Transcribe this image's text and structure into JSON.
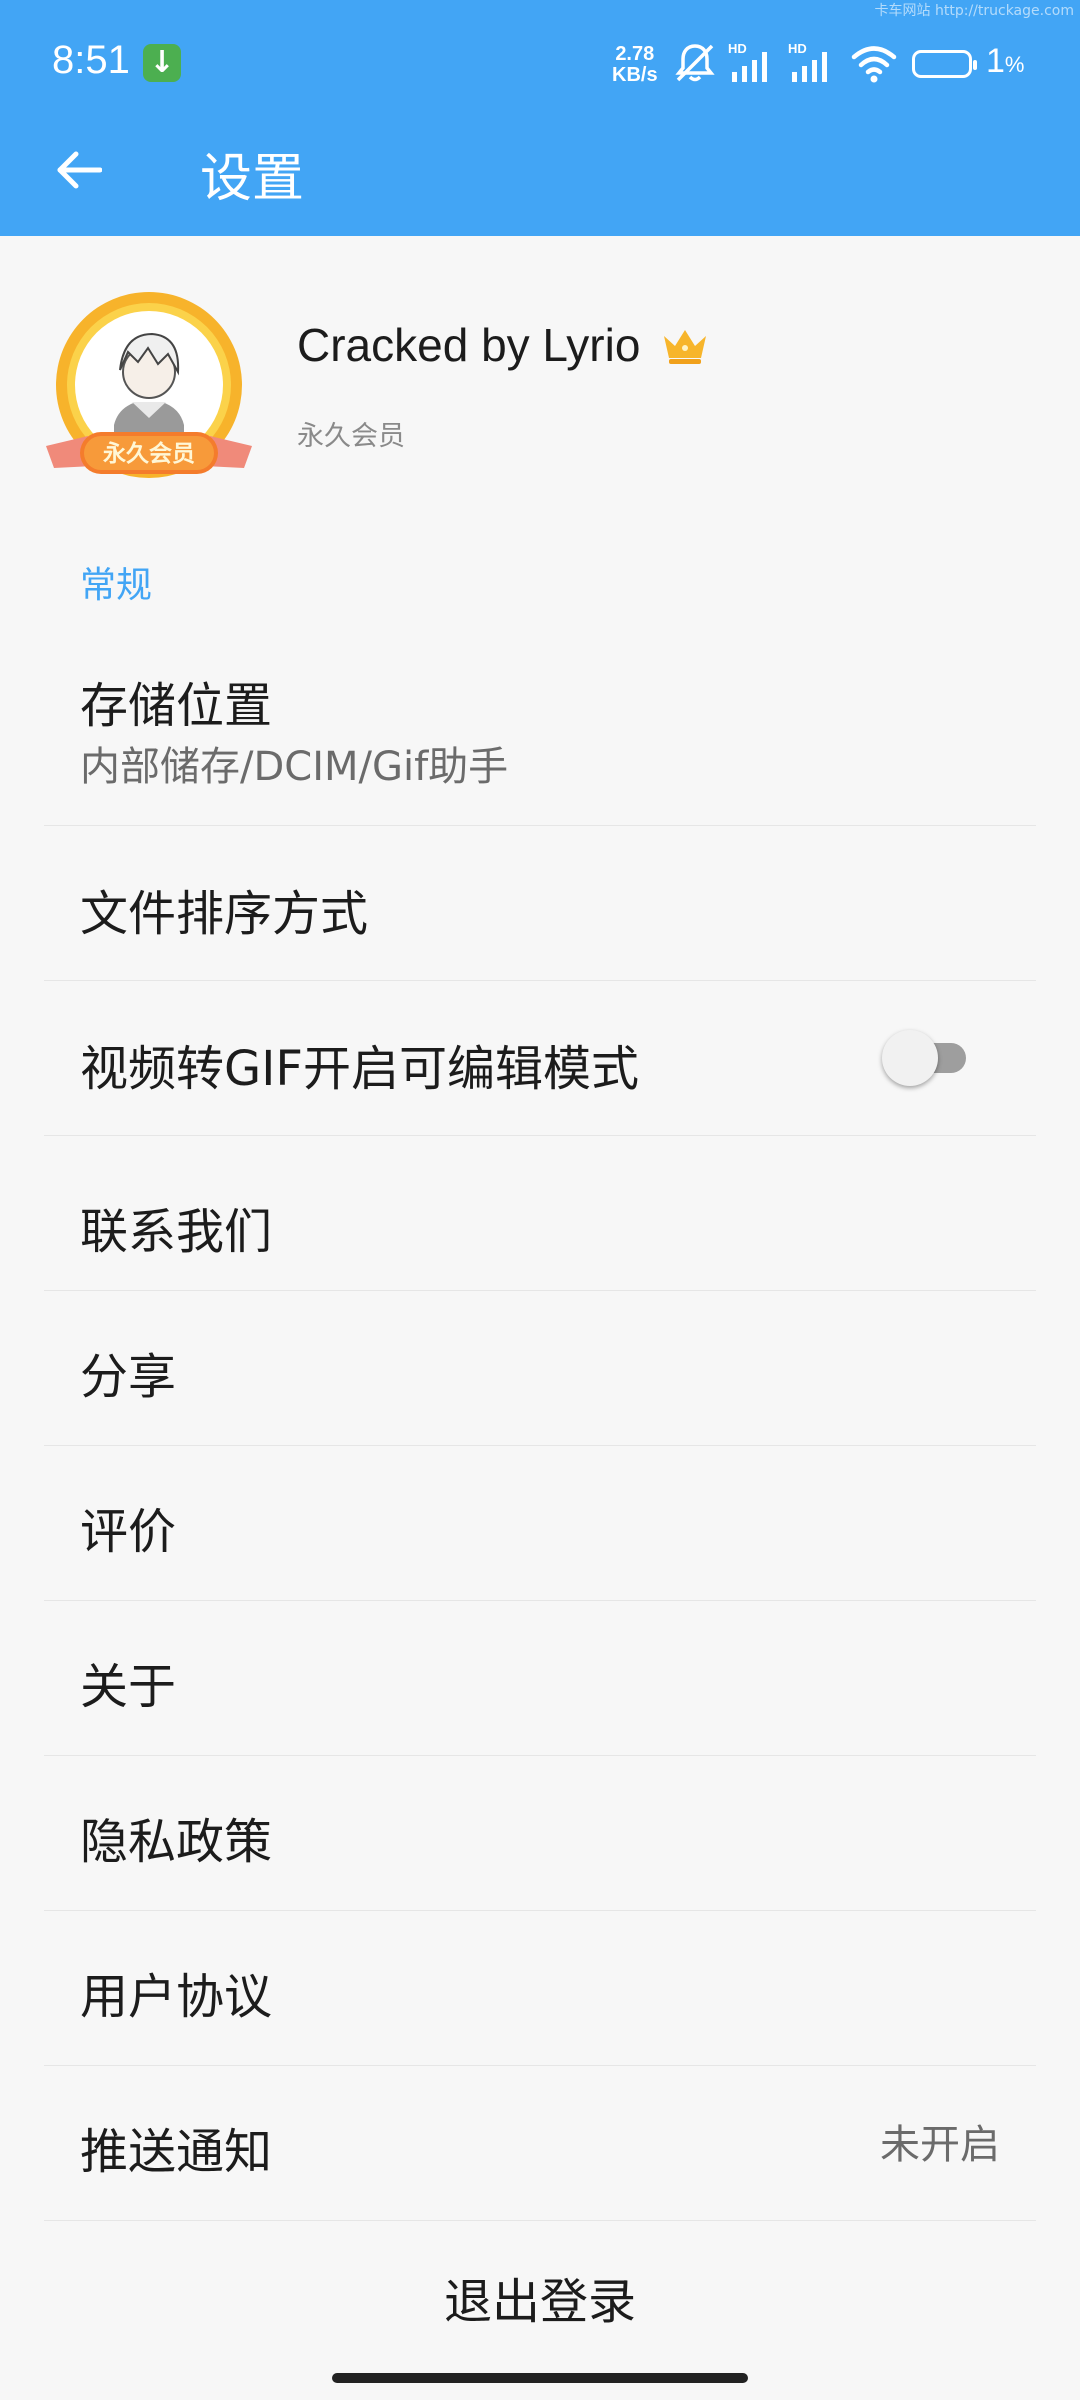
{
  "status_bar": {
    "time": "8:51",
    "network_speed_value": "2.78",
    "network_speed_unit": "KB/s",
    "signal_label_1": "HD",
    "signal_label_2": "HD",
    "battery_percent": "1",
    "battery_percent_sign": "%",
    "watermark": "卡车网站 http://truckage.com"
  },
  "header": {
    "title": "设置"
  },
  "profile": {
    "name": "Cracked by Lyrio",
    "membership": "永久会员",
    "badge_text": "永久会员"
  },
  "section_general": "常规",
  "settings": {
    "storage": {
      "label": "存储位置",
      "value": "内部储存/DCIM/Gif助手"
    },
    "sort": {
      "label": "文件排序方式"
    },
    "video_gif": {
      "label": "视频转GIF开启可编辑模式",
      "enabled": false
    },
    "contact": {
      "label": "联系我们"
    },
    "share": {
      "label": "分享"
    },
    "rate": {
      "label": "评价"
    },
    "about": {
      "label": "关于"
    },
    "privacy": {
      "label": "隐私政策"
    },
    "agreement": {
      "label": "用户协议"
    },
    "push": {
      "label": "推送通知",
      "value": "未开启"
    }
  },
  "logout_label": "退出登录",
  "colors": {
    "accent": "#42a5f5",
    "background": "#f7f7f7"
  }
}
